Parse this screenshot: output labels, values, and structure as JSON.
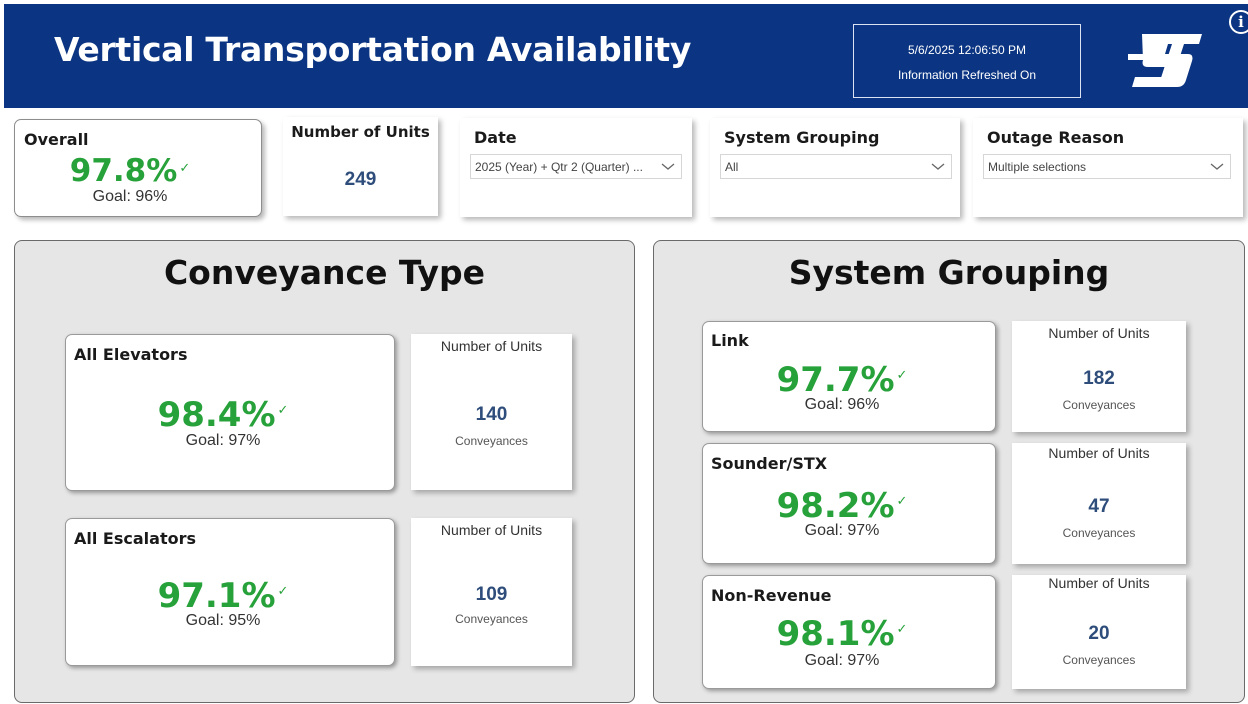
{
  "header": {
    "title": "Vertical Transportation Availability",
    "refresh_datetime": "5/6/2025 12:06:50 PM",
    "refresh_label": "Information Refreshed On",
    "info_icon": "i"
  },
  "colors": {
    "header_bg": "#0b3582",
    "kpi_green": "#27a13a",
    "units_blue": "#2e4d7b",
    "panel_bg": "#e6e6e6"
  },
  "overall": {
    "title": "Overall",
    "value": "97.8%",
    "check": "✓",
    "goal": "Goal: 96%"
  },
  "units_total": {
    "title": "Number of Units",
    "value": "249"
  },
  "filters": {
    "date": {
      "title": "Date",
      "value": "2025 (Year) + Qtr 2 (Quarter) ..."
    },
    "system_grouping": {
      "title": "System Grouping",
      "value": "All"
    },
    "outage_reason": {
      "title": "Outage Reason",
      "value": "Multiple selections"
    }
  },
  "conveyance": {
    "title": "Conveyance Type",
    "items": [
      {
        "name": "All Elevators",
        "value": "98.4%",
        "check": "✓",
        "goal": "Goal: 97%",
        "units_label": "Number of Units",
        "units": "140",
        "units_sub": "Conveyances"
      },
      {
        "name": "All Escalators",
        "value": "97.1%",
        "check": "✓",
        "goal": "Goal: 95%",
        "units_label": "Number of Units",
        "units": "109",
        "units_sub": "Conveyances"
      }
    ]
  },
  "grouping": {
    "title": "System Grouping",
    "items": [
      {
        "name": "Link",
        "value": "97.7%",
        "check": "✓",
        "goal": "Goal: 96%",
        "units_label": "Number of Units",
        "units": "182",
        "units_sub": "Conveyances"
      },
      {
        "name": "Sounder/STX",
        "value": "98.2%",
        "check": "✓",
        "goal": "Goal: 97%",
        "units_label": "Number of Units",
        "units": "47",
        "units_sub": "Conveyances"
      },
      {
        "name": "Non-Revenue",
        "value": "98.1%",
        "check": "✓",
        "goal": "Goal: 97%",
        "units_label": "Number of Units",
        "units": "20",
        "units_sub": "Conveyances"
      }
    ]
  }
}
